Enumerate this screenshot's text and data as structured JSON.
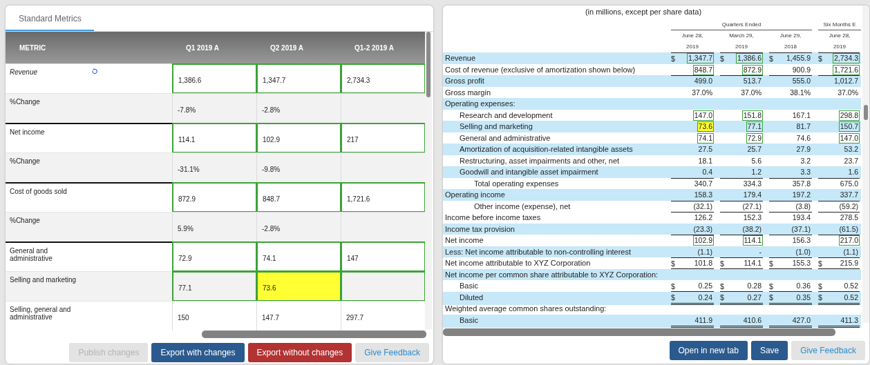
{
  "left": {
    "tabs": [
      {
        "label": "Standard Metrics",
        "selected": true
      }
    ],
    "columns": [
      "METRIC",
      "Q1 2019 A",
      "Q2 2019 A",
      "Q1-2 2019 A"
    ],
    "rows": [
      {
        "label": "Revenue",
        "edited": true,
        "shaded": false,
        "group_start": false,
        "cells": [
          {
            "value": "1,386.6",
            "matched": true,
            "highlighted": false
          },
          {
            "value": "1,347.7",
            "matched": true,
            "highlighted": false
          },
          {
            "value": "2,734.3",
            "matched": true,
            "highlighted": false
          }
        ]
      },
      {
        "label": "%Change",
        "edited": false,
        "shaded": true,
        "group_start": false,
        "cells": [
          {
            "value": "-7.8%",
            "matched": false,
            "highlighted": false
          },
          {
            "value": "-2.8%",
            "matched": false,
            "highlighted": false
          },
          {
            "matched": false,
            "highlighted": false
          }
        ]
      },
      {
        "label": "Net income",
        "edited": false,
        "shaded": false,
        "group_start": true,
        "cells": [
          {
            "value": "114.1",
            "matched": true,
            "highlighted": false
          },
          {
            "value": "102.9",
            "matched": true,
            "highlighted": false
          },
          {
            "value": "217",
            "matched": true,
            "highlighted": false
          }
        ]
      },
      {
        "label": "%Change",
        "edited": false,
        "shaded": true,
        "group_start": false,
        "cells": [
          {
            "value": "-31.1%",
            "matched": false,
            "highlighted": false
          },
          {
            "value": "-9.8%",
            "matched": false,
            "highlighted": false
          },
          {
            "matched": false,
            "highlighted": false
          }
        ]
      },
      {
        "label": "Cost of goods sold",
        "edited": false,
        "shaded": false,
        "group_start": true,
        "cells": [
          {
            "value": "872.9",
            "matched": true,
            "highlighted": false
          },
          {
            "value": "848.7",
            "matched": true,
            "highlighted": false
          },
          {
            "value": "1,721.6",
            "matched": true,
            "highlighted": false
          }
        ]
      },
      {
        "label": "%Change",
        "edited": false,
        "shaded": true,
        "group_start": false,
        "cells": [
          {
            "value": "5.9%",
            "matched": false,
            "highlighted": false
          },
          {
            "value": "-2.8%",
            "matched": false,
            "highlighted": false
          },
          {
            "matched": false,
            "highlighted": false
          }
        ]
      },
      {
        "label": "General and administrative",
        "edited": false,
        "shaded": false,
        "group_start": true,
        "cells": [
          {
            "value": "72.9",
            "matched": true,
            "highlighted": false
          },
          {
            "value": "74.1",
            "matched": true,
            "highlighted": false
          },
          {
            "value": "147",
            "matched": true,
            "highlighted": false
          }
        ]
      },
      {
        "label": "Selling and marketing",
        "edited": false,
        "shaded": true,
        "group_start": false,
        "cells": [
          {
            "value": "77.1",
            "matched": true,
            "highlighted": false
          },
          {
            "value": "73.6",
            "matched": true,
            "highlighted": true
          },
          {
            "matched": true,
            "highlighted": false
          }
        ]
      },
      {
        "label": "Selling, general and administrative",
        "edited": false,
        "shaded": false,
        "group_start": false,
        "cells": [
          {
            "value": "150",
            "matched": false,
            "highlighted": false
          },
          {
            "value": "147.7",
            "matched": false,
            "highlighted": false
          },
          {
            "value": "297.7",
            "matched": false,
            "highlighted": false
          }
        ]
      }
    ],
    "buttons": [
      {
        "label": "Publish changes",
        "kind": "primary",
        "disabled": true
      },
      {
        "label": "Export with changes",
        "kind": "primary",
        "disabled": false
      },
      {
        "label": "Export without changes",
        "kind": "danger",
        "disabled": false
      },
      {
        "label": "Give Feedback",
        "kind": "secondary",
        "disabled": false
      }
    ]
  },
  "right": {
    "caption": "(in millions, except per share data)",
    "group_headings": [
      "Quarters Ended",
      "Six Months E"
    ],
    "columns": [
      {
        "line1": "June 28,",
        "line2": "2019"
      },
      {
        "line1": "March 29,",
        "line2": "2019"
      },
      {
        "line1": "June 29,",
        "line2": "2018"
      },
      {
        "line1": "June 28,",
        "line2": "2019"
      }
    ],
    "rows": [
      {
        "label": "Revenue",
        "kind": "main",
        "shaded": true,
        "line_above": true,
        "double_below": false,
        "cells": [
          {
            "dollar": "$",
            "value": "1,347.7",
            "boxed": true,
            "highlighted": false
          },
          {
            "dollar": "$",
            "value": "1,386.6",
            "boxed": true,
            "highlighted": false
          },
          {
            "dollar": "$",
            "value": "1,455.9",
            "boxed": false,
            "highlighted": false
          },
          {
            "dollar": "$",
            "value": "2,734.3",
            "boxed": true,
            "highlighted": false
          }
        ]
      },
      {
        "label": "Cost of revenue (exclusive of amortization shown below)",
        "kind": "main",
        "shaded": false,
        "line_above": false,
        "double_below": false,
        "cells": [
          {
            "value": "848.7",
            "boxed": true,
            "highlighted": false
          },
          {
            "value": "872.9",
            "boxed": true,
            "highlighted": false
          },
          {
            "value": "900.9",
            "boxed": false,
            "highlighted": false
          },
          {
            "value": "1,721.6",
            "boxed": true,
            "highlighted": false
          }
        ]
      },
      {
        "label": "Gross profit",
        "kind": "main",
        "shaded": true,
        "line_above": true,
        "double_below": false,
        "cells": [
          {
            "value": "499.0",
            "boxed": false,
            "highlighted": false
          },
          {
            "value": "513.7",
            "boxed": false,
            "highlighted": false
          },
          {
            "value": "555.0",
            "boxed": false,
            "highlighted": false
          },
          {
            "value": "1,012.7",
            "boxed": false,
            "highlighted": false
          }
        ]
      },
      {
        "label": "Gross margin",
        "kind": "main",
        "shaded": false,
        "line_above": false,
        "double_below": false,
        "cells": [
          {
            "value": "37.0%",
            "boxed": false,
            "highlighted": false
          },
          {
            "value": "37.0%",
            "boxed": false,
            "highlighted": false
          },
          {
            "value": "38.1%",
            "boxed": false,
            "highlighted": false
          },
          {
            "value": "37.0%",
            "boxed": false,
            "highlighted": false
          }
        ]
      },
      {
        "label": "Operating expenses:",
        "kind": "main",
        "shaded": true
      },
      {
        "label": "Research and development",
        "kind": "sub",
        "shaded": false,
        "line_above": false,
        "double_below": false,
        "cells": [
          {
            "value": "147.0",
            "boxed": true,
            "highlighted": false
          },
          {
            "value": "151.8",
            "boxed": true,
            "highlighted": false
          },
          {
            "value": "167.1",
            "boxed": false,
            "highlighted": false
          },
          {
            "value": "298.8",
            "boxed": true,
            "highlighted": false
          }
        ]
      },
      {
        "label": "Selling and marketing",
        "kind": "sub",
        "shaded": true,
        "line_above": false,
        "double_below": false,
        "cells": [
          {
            "value": "73.6",
            "boxed": true,
            "highlighted": true
          },
          {
            "value": "77.1",
            "boxed": true,
            "highlighted": false
          },
          {
            "value": "81.7",
            "boxed": false,
            "highlighted": false
          },
          {
            "value": "150.7",
            "boxed": true,
            "highlighted": false
          }
        ]
      },
      {
        "label": "General and administrative",
        "kind": "sub",
        "shaded": false,
        "line_above": false,
        "double_below": false,
        "cells": [
          {
            "value": "74.1",
            "boxed": true,
            "highlighted": false
          },
          {
            "value": "72.9",
            "boxed": true,
            "highlighted": false
          },
          {
            "value": "74.6",
            "boxed": false,
            "highlighted": false
          },
          {
            "value": "147.0",
            "boxed": true,
            "highlighted": false
          }
        ]
      },
      {
        "label": "Amortization of acquisition-related intangible assets",
        "kind": "sub",
        "shaded": true,
        "line_above": false,
        "double_below": false,
        "cells": [
          {
            "value": "27.5",
            "boxed": false,
            "highlighted": false
          },
          {
            "value": "25.7",
            "boxed": false,
            "highlighted": false
          },
          {
            "value": "27.9",
            "boxed": false,
            "highlighted": false
          },
          {
            "value": "53.2",
            "boxed": false,
            "highlighted": false
          }
        ]
      },
      {
        "label": "Restructuring, asset impairments and other, net",
        "kind": "sub",
        "shaded": false,
        "line_above": false,
        "double_below": false,
        "cells": [
          {
            "value": "18.1",
            "boxed": false,
            "highlighted": false
          },
          {
            "value": "5.6",
            "boxed": false,
            "highlighted": false
          },
          {
            "value": "3.2",
            "boxed": false,
            "highlighted": false
          },
          {
            "value": "23.7",
            "boxed": false,
            "highlighted": false
          }
        ]
      },
      {
        "label": "Goodwill and intangible asset impairment",
        "kind": "sub",
        "shaded": true,
        "line_above": false,
        "double_below": false,
        "cells": [
          {
            "value": "0.4",
            "boxed": false,
            "highlighted": false
          },
          {
            "value": "1.2",
            "boxed": false,
            "highlighted": false
          },
          {
            "value": "3.3",
            "boxed": false,
            "highlighted": false
          },
          {
            "value": "1.6",
            "boxed": false,
            "highlighted": false
          }
        ]
      },
      {
        "label": "Total operating expenses",
        "kind": "total",
        "shaded": false,
        "line_above": true,
        "double_below": false,
        "cells": [
          {
            "value": "340.7",
            "boxed": false,
            "highlighted": false
          },
          {
            "value": "334.3",
            "boxed": false,
            "highlighted": false
          },
          {
            "value": "357.8",
            "boxed": false,
            "highlighted": false
          },
          {
            "value": "675.0",
            "boxed": false,
            "highlighted": false
          }
        ]
      },
      {
        "label": "Operating income",
        "kind": "main",
        "shaded": true,
        "line_above": false,
        "double_below": false,
        "cells": [
          {
            "value": "158.3",
            "boxed": false,
            "highlighted": false
          },
          {
            "value": "179.4",
            "boxed": false,
            "highlighted": false
          },
          {
            "value": "197.2",
            "boxed": false,
            "highlighted": false
          },
          {
            "value": "337.7",
            "boxed": false,
            "highlighted": false
          }
        ]
      },
      {
        "label": "Other income (expense), net",
        "kind": "total",
        "shaded": false,
        "line_above": true,
        "double_below": false,
        "cells": [
          {
            "value": "(32.1)",
            "boxed": false,
            "highlighted": false
          },
          {
            "value": "(27.1)",
            "boxed": false,
            "highlighted": false
          },
          {
            "value": "(3.8)",
            "boxed": false,
            "highlighted": false
          },
          {
            "value": "(59.2)",
            "boxed": false,
            "highlighted": false
          }
        ]
      },
      {
        "label": "Income before income taxes",
        "kind": "main",
        "shaded": false,
        "line_above": true,
        "double_below": false,
        "cells": [
          {
            "value": "126.2",
            "boxed": false,
            "highlighted": false
          },
          {
            "value": "152.3",
            "boxed": false,
            "highlighted": false
          },
          {
            "value": "193.4",
            "boxed": false,
            "highlighted": false
          },
          {
            "value": "278.5",
            "boxed": false,
            "highlighted": false
          }
        ]
      },
      {
        "label": "Income tax provision",
        "kind": "main",
        "shaded": true,
        "line_above": false,
        "double_below": false,
        "cells": [
          {
            "value": "(23.3)",
            "boxed": false,
            "highlighted": false
          },
          {
            "value": "(38.2)",
            "boxed": false,
            "highlighted": false
          },
          {
            "value": "(37.1)",
            "boxed": false,
            "highlighted": false
          },
          {
            "value": "(61.5)",
            "boxed": false,
            "highlighted": false
          }
        ]
      },
      {
        "label": "Net income",
        "kind": "main",
        "shaded": false,
        "line_above": true,
        "double_below": false,
        "cells": [
          {
            "value": "102.9",
            "boxed": true,
            "highlighted": false
          },
          {
            "value": "114.1",
            "boxed": true,
            "highlighted": false
          },
          {
            "value": "156.3",
            "boxed": false,
            "highlighted": false
          },
          {
            "value": "217.0",
            "boxed": true,
            "highlighted": false
          }
        ]
      },
      {
        "label": "Less: Net income attributable to non-controlling interest",
        "kind": "main",
        "shaded": true,
        "line_above": false,
        "double_below": false,
        "cells": [
          {
            "value": "(1.1)",
            "boxed": false,
            "highlighted": false
          },
          {
            "value": "-",
            "boxed": false,
            "highlighted": false
          },
          {
            "value": "(1.0)",
            "boxed": false,
            "highlighted": false
          },
          {
            "value": "(1.1)",
            "boxed": false,
            "highlighted": false
          }
        ]
      },
      {
        "label": "Net income attributable to XYZ Corporation",
        "kind": "main",
        "shaded": false,
        "line_above": true,
        "double_below": true,
        "cells": [
          {
            "dollar": "$",
            "value": "101.8",
            "boxed": false,
            "highlighted": false
          },
          {
            "dollar": "$",
            "value": "114.1",
            "boxed": false,
            "highlighted": false
          },
          {
            "dollar": "$",
            "value": "155.3",
            "boxed": false,
            "highlighted": false
          },
          {
            "dollar": "$",
            "value": "215.9",
            "boxed": false,
            "highlighted": false
          }
        ]
      },
      {
        "label": "Net income per common share attributable to XYZ Corporation:",
        "kind": "main",
        "shaded": true
      },
      {
        "label": "Basic",
        "kind": "sub",
        "shaded": false,
        "line_above": false,
        "double_below": true,
        "cells": [
          {
            "dollar": "$",
            "value": "0.25",
            "boxed": false,
            "highlighted": false
          },
          {
            "dollar": "$",
            "value": "0.28",
            "boxed": false,
            "highlighted": false
          },
          {
            "dollar": "$",
            "value": "0.36",
            "boxed": false,
            "highlighted": false
          },
          {
            "dollar": "$",
            "value": "0.52",
            "boxed": false,
            "highlighted": false
          }
        ]
      },
      {
        "label": "Diluted",
        "kind": "sub",
        "shaded": true,
        "line_above": false,
        "double_below": true,
        "cells": [
          {
            "dollar": "$",
            "value": "0.24",
            "boxed": false,
            "highlighted": false
          },
          {
            "dollar": "$",
            "value": "0.27",
            "boxed": false,
            "highlighted": false
          },
          {
            "dollar": "$",
            "value": "0.35",
            "boxed": false,
            "highlighted": false
          },
          {
            "dollar": "$",
            "value": "0.52",
            "boxed": false,
            "highlighted": false
          }
        ]
      },
      {
        "label": "Weighted average common shares outstanding:",
        "kind": "main",
        "shaded": false
      },
      {
        "label": "Basic",
        "kind": "sub",
        "shaded": true,
        "line_above": false,
        "double_below": true,
        "cells": [
          {
            "value": "411.9",
            "boxed": false,
            "highlighted": false
          },
          {
            "value": "410.6",
            "boxed": false,
            "highlighted": false
          },
          {
            "value": "427.0",
            "boxed": false,
            "highlighted": false
          },
          {
            "value": "411.3",
            "boxed": false,
            "highlighted": false
          }
        ]
      }
    ],
    "buttons": [
      {
        "label": "Open in new tab",
        "kind": "primary",
        "disabled": false
      },
      {
        "label": "Save",
        "kind": "primary",
        "disabled": false
      },
      {
        "label": "Give Feedback",
        "kind": "secondary",
        "disabled": false
      }
    ]
  }
}
